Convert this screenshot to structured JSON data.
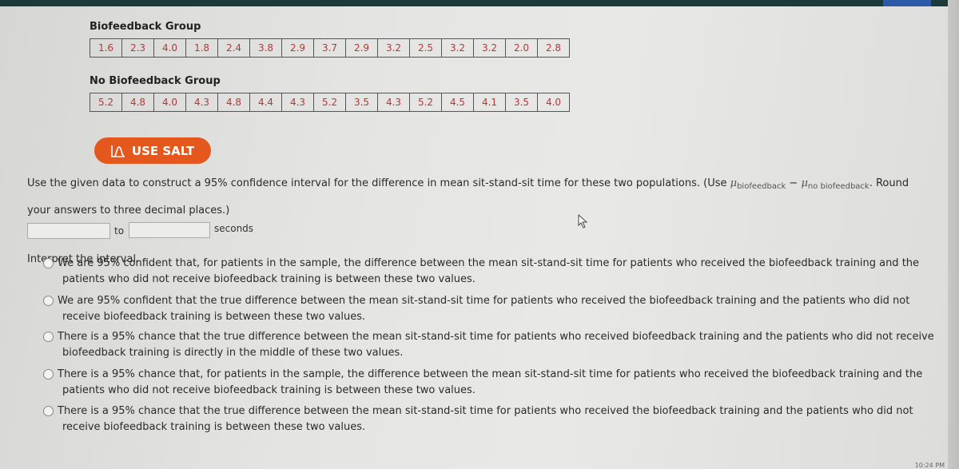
{
  "biofeedback_group": {
    "label": "Biofeedback Group",
    "values": [
      "1.6",
      "2.3",
      "4.0",
      "1.8",
      "2.4",
      "3.8",
      "2.9",
      "3.7",
      "2.9",
      "3.2",
      "2.5",
      "3.2",
      "3.2",
      "2.0",
      "2.8"
    ]
  },
  "no_biofeedback_group": {
    "label": "No Biofeedback Group",
    "values": [
      "5.2",
      "4.8",
      "4.0",
      "4.3",
      "4.8",
      "4.4",
      "4.3",
      "5.2",
      "3.5",
      "4.3",
      "5.2",
      "4.5",
      "4.1",
      "3.5",
      "4.0"
    ]
  },
  "salt_button": {
    "label": "USE SALT",
    "icon": "bell-curve-icon",
    "color": "#e4571d"
  },
  "question": {
    "line1_prefix": "Use the given data to construct a 95% confidence interval for the difference in mean sit-stand-sit time for these two populations. (Use ",
    "mu": "μ",
    "sub1": "biofeedback",
    "minus": " − ",
    "sub2": "no biofeedback",
    "line1_suffix": ". Round",
    "line2": "your answers to three decimal places.)"
  },
  "answer": {
    "lower_value": "",
    "to_label": "to",
    "upper_value": "",
    "unit_label": "seconds"
  },
  "interpret": {
    "label": "Interpret the interval.",
    "options": [
      {
        "line1": "We are 95% confident that, for patients in the sample, the difference between the mean sit-stand-sit time for patients who received the biofeedback training and the",
        "line2": "patients who did not receive biofeedback training is between these two values.",
        "selected": false
      },
      {
        "line1": "We are 95% confident that the true difference between the mean sit-stand-sit time for patients who received the biofeedback training and the patients who did not",
        "line2": "receive biofeedback training is between these two values.",
        "selected": false
      },
      {
        "line1": "There is a 95% chance that the true difference between the mean sit-stand-sit time for patients who received biofeedback training and the patients who did not receive",
        "line2": "biofeedback training is directly in the middle of these two values.",
        "selected": false
      },
      {
        "line1": "There is a 95% chance that, for patients in the sample, the difference between the mean sit-stand-sit time for patients who received the biofeedback training and the",
        "line2": "patients who did not receive biofeedback training is between these two values.",
        "selected": false
      },
      {
        "line1": "There is a 95% chance that the true difference between the mean sit-stand-sit time for patients who received the biofeedback training and the patients who did not",
        "line2": "receive biofeedback training is between these two values.",
        "selected": false
      }
    ]
  },
  "clock": "10:24 PM"
}
